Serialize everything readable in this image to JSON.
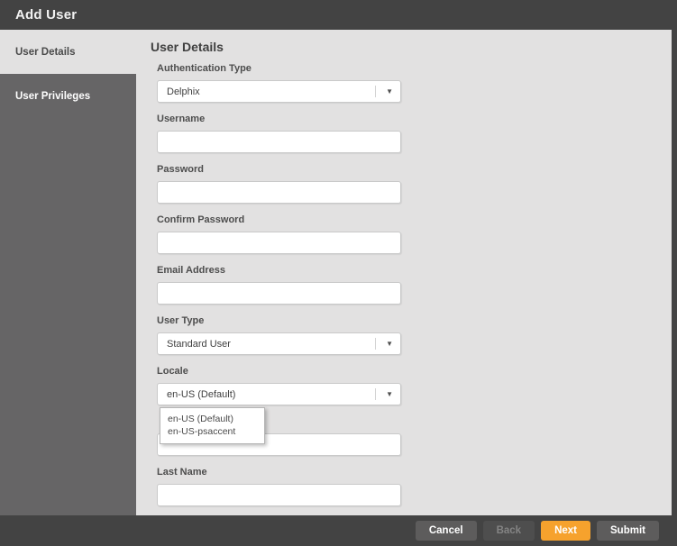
{
  "dialog": {
    "title": "Add User"
  },
  "sidebar": {
    "items": [
      {
        "label": "User Details",
        "active": true
      },
      {
        "label": "User Privileges",
        "active": false
      }
    ]
  },
  "main": {
    "heading": "User Details",
    "fields": [
      {
        "label": "Authentication Type",
        "type": "select",
        "value": "Delphix"
      },
      {
        "label": "Username",
        "type": "text",
        "value": ""
      },
      {
        "label": "Password",
        "type": "password",
        "value": ""
      },
      {
        "label": "Confirm Password",
        "type": "password",
        "value": ""
      },
      {
        "label": "Email Address",
        "type": "text",
        "value": ""
      },
      {
        "label": "User Type",
        "type": "select",
        "value": "Standard User"
      },
      {
        "label": "Locale",
        "type": "select",
        "value": "en-US (Default)",
        "open": true,
        "options": [
          "en-US (Default)",
          "en-US-psaccent"
        ]
      },
      {
        "type": "text",
        "value": ""
      },
      {
        "label": "Last Name",
        "type": "text",
        "value": ""
      }
    ]
  },
  "icons": {
    "select_arrow": "▼"
  },
  "footer": {
    "buttons": [
      {
        "label": "Cancel",
        "style": "gray",
        "disabled": false
      },
      {
        "label": "Back",
        "style": "gray",
        "disabled": true
      },
      {
        "label": "Next",
        "style": "orange",
        "disabled": false
      },
      {
        "label": "Submit",
        "style": "gray",
        "disabled": false
      }
    ]
  },
  "colors": {
    "header_bg": "#434343",
    "sidebar_bg": "#666566",
    "content_bg": "#e2e1e1",
    "accent_orange": "#f6a22d",
    "button_gray": "#5d5c5c"
  }
}
